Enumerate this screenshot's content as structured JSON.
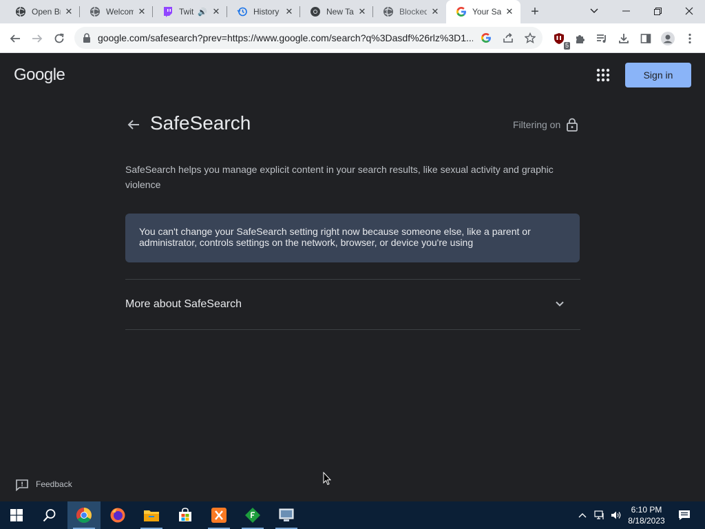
{
  "tabs": [
    {
      "title": "Open Br",
      "icon": "globe-icon"
    },
    {
      "title": "Welcom",
      "icon": "globe-icon"
    },
    {
      "title": "Twit",
      "icon": "twitch-icon",
      "audio": true
    },
    {
      "title": "History",
      "icon": "history-icon"
    },
    {
      "title": "New Tal",
      "icon": "chrome-icon"
    },
    {
      "title": "Blocked",
      "icon": "globe-icon"
    },
    {
      "title": "Your Sa",
      "icon": "google-icon",
      "active": true
    }
  ],
  "toolbar": {
    "url": "google.com/safesearch?prev=https://www.google.com/search?q%3Dasdf%26rlz%3D1...",
    "extension_badge": "5"
  },
  "page": {
    "logo": "Google",
    "sign_in": "Sign in",
    "title": "SafeSearch",
    "filter_status": "Filtering on",
    "description": "SafeSearch helps you manage explicit content in your search results, like sexual activity and graphic violence",
    "notice": "You can't change your SafeSearch setting right now because someone else, like a parent or administrator, controls settings on the network, browser, or device you're using",
    "more_about": "More about SafeSearch",
    "feedback": "Feedback"
  },
  "taskbar": {
    "time": "6:10 PM",
    "date": "8/18/2023"
  },
  "colors": {
    "page_bg": "#202124",
    "accent_blue": "#8ab4f8",
    "notice_bg": "#394457",
    "taskbar_bg": "#0b1f36"
  }
}
